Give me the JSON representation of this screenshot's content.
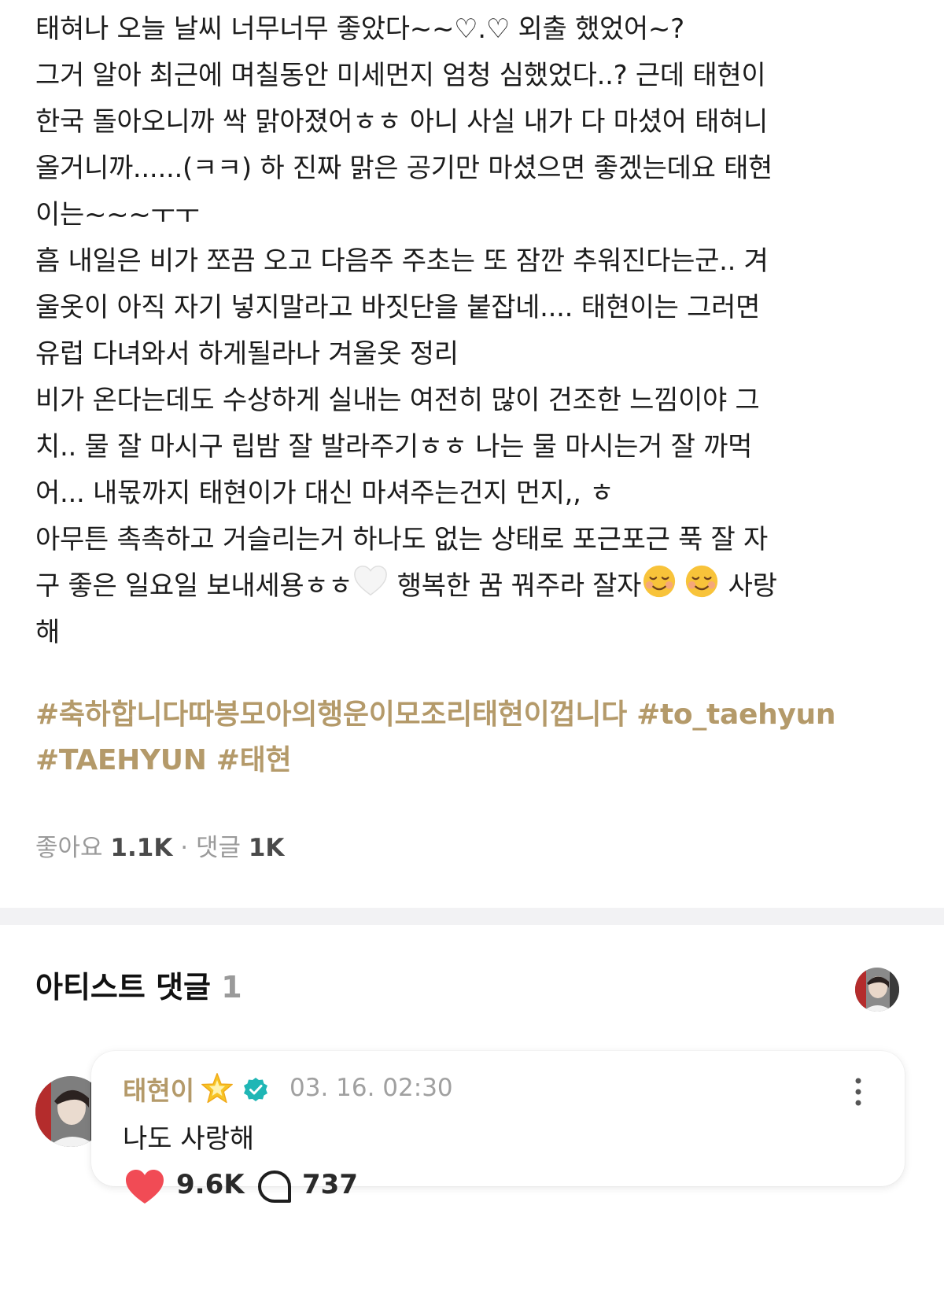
{
  "post": {
    "lines": [
      "태혀나 오늘 날씨 너무너무 좋았다~~♡.♡ 외출 했었어~?",
      "그거 알아 최근에 며칠동안 미세먼지 엄청 심했었다..? 근데 태현이",
      "한국 돌아오니까 싹 맑아졌어ㅎㅎ 아니 사실 내가 다 마셨어 태혀니",
      "올거니까......(ㅋㅋ) 하 진짜 맑은 공기만 마셨으면 좋겠는데요 태현",
      "이는~~~ㅜㅜ",
      "흠 내일은 비가 쪼끔 오고 다음주 주초는 또 잠깐 추워진다는군.. 겨",
      "울옷이 아직 자기 넣지말라고 바짓단을 붙잡네.... 태현이는 그러면",
      "유럽 다녀와서 하게될라나 겨울옷 정리",
      "비가 온다는데도 수상하게 실내는 여전히 많이 건조한 느낌이야 그",
      "치.. 물 잘 마시구 립밤 잘 발라주기ㅎㅎ 나는 물 마시는거 잘 까먹",
      "어... 내몫까지 태현이가 대신 마셔주는건지 먼지,, ㅎ",
      "아무튼 촉촉하고 거슬리는거 하나도 없는 상태로 포근포근 푹 잘 자",
      "해"
    ],
    "line12_part1": "구 좋은 일요일 보내세용ㅎㅎ",
    "line12_part2": " 행복한 꿈 꿔주라 잘자",
    "line12_part3": " 사랑",
    "emojis": [
      "white-heart-icon",
      "smiling-face-icon"
    ],
    "hashtags": [
      "#축하합니다따봉모아의행운이모조리태현이껍니다",
      "#to_taehyun",
      "#TAEHYUN",
      "#태현"
    ],
    "likes_label": "좋아요",
    "likes_count": "1.1K",
    "dot": "·",
    "comments_label": "댓글",
    "comments_count": "1K"
  },
  "artist_comments": {
    "title": "아티스트 댓글",
    "count": "1",
    "comment": {
      "author": "태현이",
      "timestamp": "03. 16. 02:30",
      "text": "나도 사랑해",
      "likes": "9.6K",
      "replies": "737"
    }
  },
  "colors": {
    "hashtag": "#b49a6a",
    "author": "#b49a6a",
    "heart": "#f14b55",
    "verified": "#1fb6b5",
    "separator": "#f2f2f4"
  }
}
